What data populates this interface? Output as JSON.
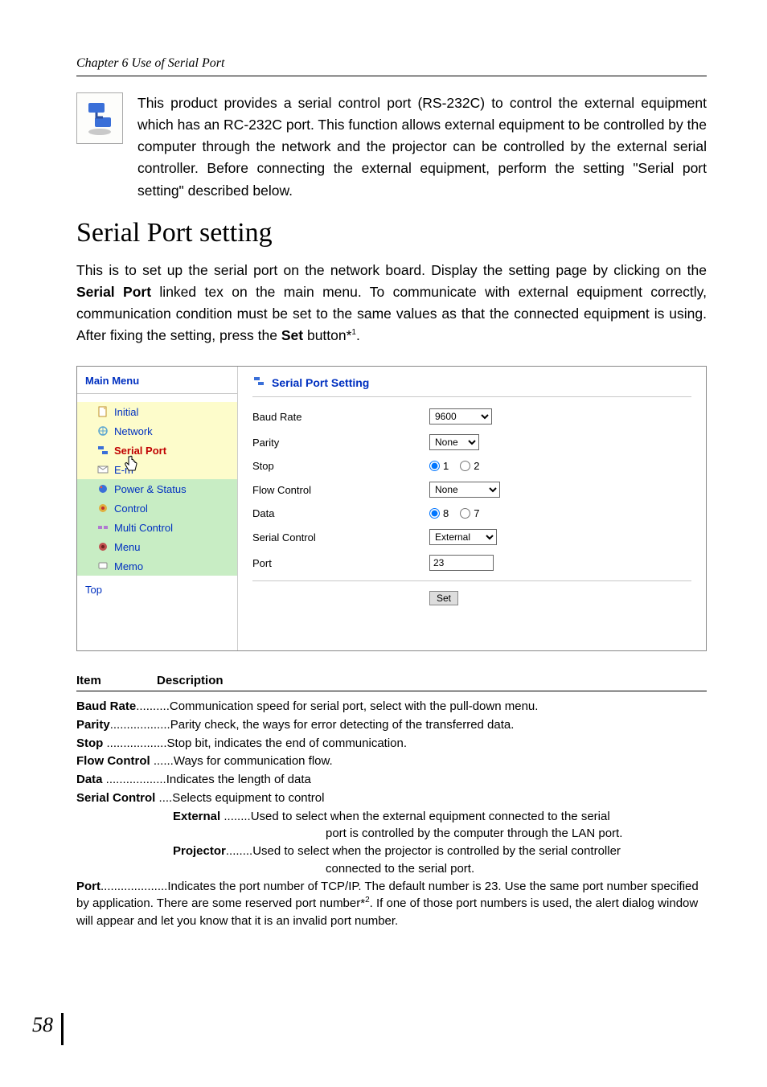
{
  "chapter_header": "Chapter 6 Use of Serial Port",
  "intro_paragraph": "This product provides a serial control port (RS-232C) to control the external equipment which has an RC-232C port. This function allows external equipment to be controlled by the computer through the network and the projector can be controlled by the external serial controller. Before connecting the external equipment, perform the setting \"Serial port setting\" described below.",
  "section_title": "Serial Port setting",
  "section_lead_pre": "This is to set up the serial port on the network board. Display the setting page by clicking on the ",
  "section_lead_bold1": "Serial Port",
  "section_lead_mid": " linked tex on the main menu. To communicate with external equipment correctly, communication condition must be set to the same values as that the connected equipment is using. After fixing the setting, press the ",
  "section_lead_bold2": "Set",
  "section_lead_post": " button*",
  "section_lead_sup": "1",
  "section_lead_end": ".",
  "ui": {
    "sidebar_title": "Main Menu",
    "items": [
      {
        "label": "Initial"
      },
      {
        "label": "Network"
      },
      {
        "label": "Serial Port"
      },
      {
        "label": "E-m"
      },
      {
        "label": "Power & Status"
      },
      {
        "label": "Control"
      },
      {
        "label": "Multi Control"
      },
      {
        "label": "Menu"
      },
      {
        "label": "Memo"
      }
    ],
    "top_label": "Top",
    "main_title": "Serial Port Setting",
    "rows": {
      "baud_label": "Baud Rate",
      "baud_value": "9600",
      "parity_label": "Parity",
      "parity_value": "None",
      "stop_label": "Stop",
      "stop_opt1": "1",
      "stop_opt2": "2",
      "flow_label": "Flow Control",
      "flow_value": "None",
      "data_label": "Data",
      "data_opt1": "8",
      "data_opt2": "7",
      "serialctl_label": "Serial Control",
      "serialctl_value": "External",
      "port_label": "Port",
      "port_value": "23"
    },
    "set_label": "Set"
  },
  "desc": {
    "col1": "Item",
    "col2": "Description",
    "rows": [
      {
        "item": "Baud Rate",
        "dots": "..........",
        "text": "Communication speed for serial port, select with the pull-down menu."
      },
      {
        "item": "Parity",
        "dots": "..................",
        "text": "Parity check, the ways for error detecting of the transferred data."
      },
      {
        "item": "Stop",
        "dots": " ..................",
        "text": "Stop bit, indicates the end of communication."
      },
      {
        "item": "Flow Control",
        "dots": " ......",
        "text": "Ways for communication flow."
      },
      {
        "item": "Data",
        "dots": " ..................",
        "text": "Indicates the length of data"
      },
      {
        "item": "Serial Control",
        "dots": " ....",
        "text": "Selects equipment to control"
      }
    ],
    "sub": [
      {
        "item": "External",
        "dots": " ........",
        "text": "Used to select when the external equipment connected to the serial port is controlled by the computer through the LAN port."
      },
      {
        "item": "Projector",
        "dots": "........",
        "text": "Used to select when the projector is controlled by the serial controller connected to the serial port."
      }
    ],
    "port_item": "Port",
    "port_dots": "....................",
    "port_text_1": "Indicates the port number of TCP/IP. The default number is 23. Use the same port number specified by application. There are some reserved port number*",
    "port_sup": "2",
    "port_text_2": ". If one of those port numbers is used, the alert dialog window will appear and let you know that it is an invalid port number."
  },
  "page_number": "58"
}
